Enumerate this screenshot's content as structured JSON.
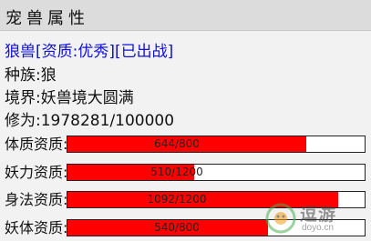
{
  "window": {
    "title": "宠兽属性"
  },
  "pet": {
    "name_line": "狼兽[资质:优秀][已出战]",
    "race": "种族:狼",
    "realm": "境界:妖兽境大圆满",
    "cultivation": "修为:1978281/100000"
  },
  "stats": [
    {
      "label": "体质资质:",
      "value_text": "644/800",
      "fill": 0.805
    },
    {
      "label": "妖力资质:",
      "value_text": "510/1200",
      "fill": 0.425
    },
    {
      "label": "身法资质:",
      "value_text": "1092/1200",
      "fill": 0.91
    },
    {
      "label": "妖体资质:",
      "value_text": "540/800",
      "fill": 0.675
    }
  ],
  "watermark": {
    "brand": "逗游",
    "site": "doyo.cn"
  },
  "colors": {
    "bar_fill": "#ff0000",
    "pet_name": "#1010d8",
    "bar_bg": "#ffffff"
  }
}
